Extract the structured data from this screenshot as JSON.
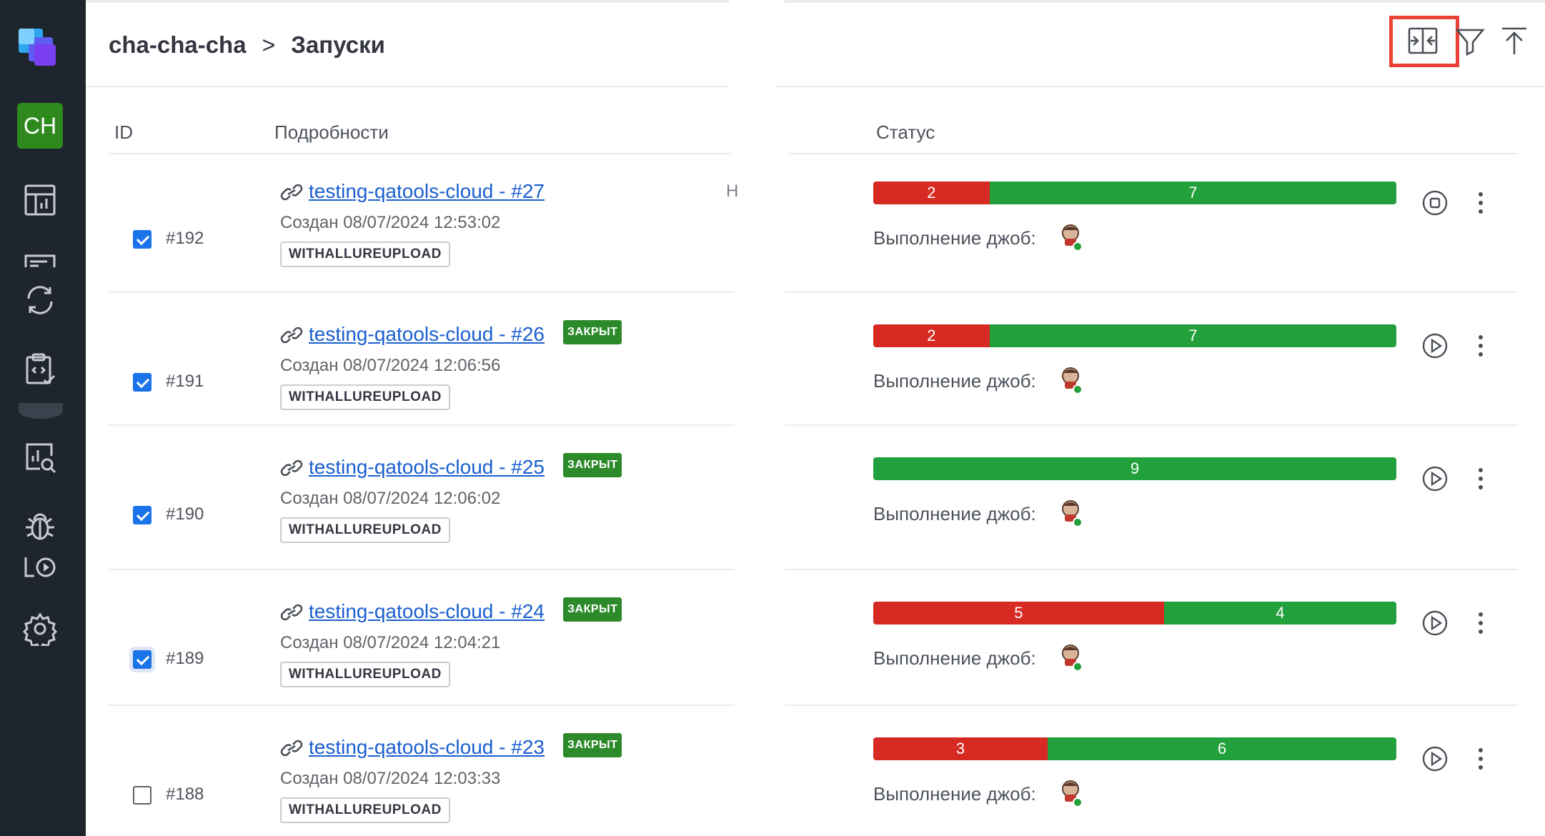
{
  "sidebar": {
    "avatar": "CH",
    "icons": [
      "logo-icon",
      "dashboard-icon",
      "test-cases-icon",
      "launches-icon",
      "test-plans-icon",
      "analytics-icon",
      "defects-icon",
      "jobs-icon",
      "settings-icon"
    ]
  },
  "header": {
    "project": "cha-cha-cha",
    "separator": ">",
    "page_title": "Запуски",
    "actions": [
      "split-view-icon",
      "filter-icon",
      "upload-icon"
    ]
  },
  "table": {
    "headers": {
      "id": "ID",
      "details": "Подробности",
      "status": "Статус"
    },
    "jobs_label": "Выполнение джоб:",
    "rows": [
      {
        "id": "#192",
        "checked": true,
        "name": "testing-qatools-cloud - #27",
        "closed": "",
        "created": "Создан 08/07/2024 12:53:02",
        "tag": "WITHALLUREUPLOAD",
        "trunc": "Н",
        "failed": 2,
        "passed": 7,
        "action": "stop-icon"
      },
      {
        "id": "#191",
        "checked": true,
        "name": "testing-qatools-cloud - #26",
        "closed": "ЗАКРЫТ",
        "created": "Создан 08/07/2024 12:06:56",
        "tag": "WITHALLUREUPLOAD",
        "trunc": "",
        "failed": 2,
        "passed": 7,
        "action": "play-icon"
      },
      {
        "id": "#190",
        "checked": true,
        "name": "testing-qatools-cloud - #25",
        "closed": "ЗАКРЫТ",
        "created": "Создан 08/07/2024 12:06:02",
        "tag": "WITHALLUREUPLOAD",
        "trunc": "",
        "failed": 0,
        "passed": 9,
        "action": "play-icon"
      },
      {
        "id": "#189",
        "checked": true,
        "name": "testing-qatools-cloud - #24",
        "closed": "ЗАКРЫТ",
        "created": "Создан 08/07/2024 12:04:21",
        "tag": "WITHALLUREUPLOAD",
        "trunc": "",
        "failed": 5,
        "passed": 4,
        "action": "play-icon"
      },
      {
        "id": "#188",
        "checked": false,
        "name": "testing-qatools-cloud - #23",
        "closed": "ЗАКРЫТ",
        "created": "Создан 08/07/2024 12:03:33",
        "tag": "WITHALLUREUPLOAD",
        "trunc": "",
        "failed": 3,
        "passed": 6,
        "action": "play-icon"
      }
    ]
  },
  "colors": {
    "failed": "#d62a22",
    "passed": "#22a03b",
    "link": "#1a5fd0",
    "sidebar": "#1f252d",
    "avatar": "#2f8a1e",
    "highlight": "#ea4335"
  }
}
